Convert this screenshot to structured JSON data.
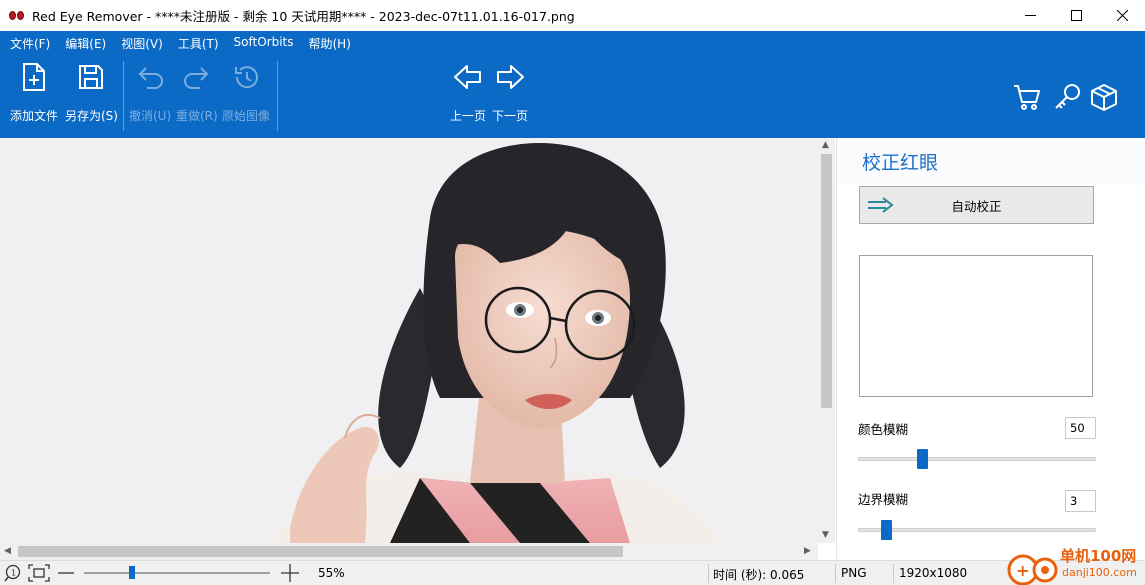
{
  "window": {
    "title": "Red Eye Remover - ****未注册版 - 剩余 10 天试用期**** - 2023-dec-07t11.01.16-017.png"
  },
  "menu": [
    "文件(F)",
    "编辑(E)",
    "视图(V)",
    "工具(T)",
    "SoftOrbits",
    "帮助(H)"
  ],
  "toolbar": {
    "add_file": "添加文件",
    "save_as": "另存为(S)",
    "undo": "撤消(U)",
    "redo": "重做(R)",
    "original": "原始图像",
    "prev_page": "上一页",
    "next_page": "下一页"
  },
  "panel": {
    "title": "校正红眼",
    "auto_correct": "自动校正",
    "color_blur_label": "颜色模糊",
    "color_blur_value": "50",
    "color_blur_level": 0.26,
    "edge_blur_label": "边界模糊",
    "edge_blur_value": "3",
    "edge_blur_level": 0.1
  },
  "status": {
    "zoom": "55%",
    "time": "时间 (秒): 0.065",
    "format": "PNG",
    "dimensions": "1920x1080"
  },
  "watermark": {
    "text": "单机100网",
    "url": "danji100.com"
  },
  "colors": {
    "accent": "#0b6ac6",
    "panel_title": "#1c6fc8"
  }
}
